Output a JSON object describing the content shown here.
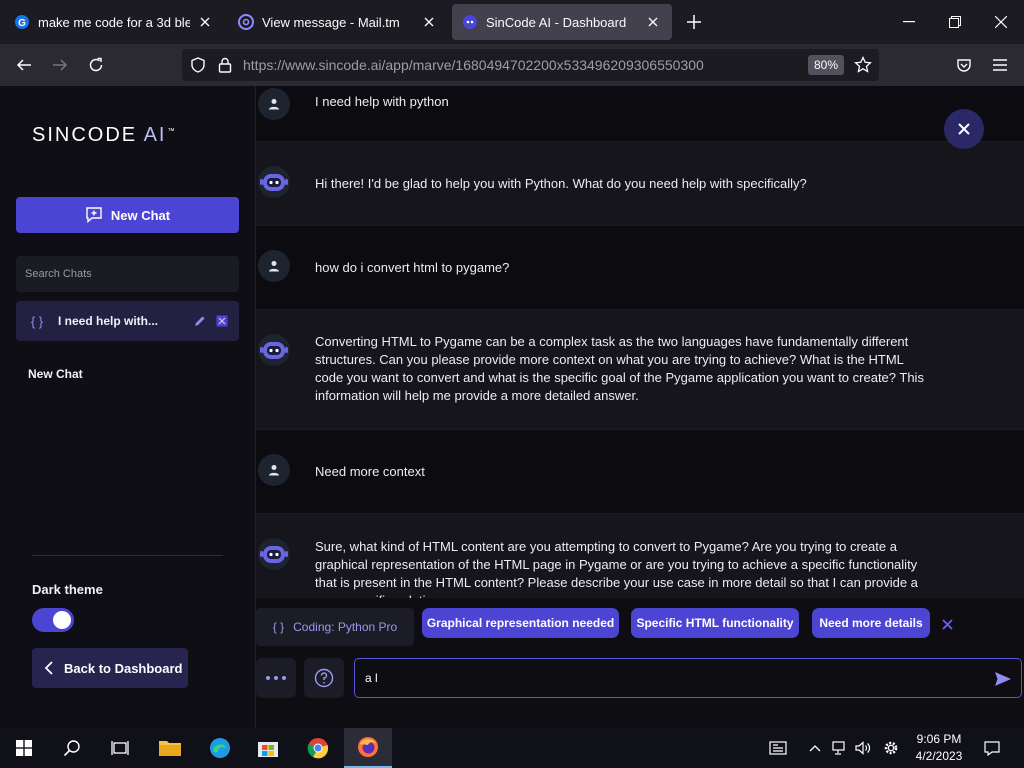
{
  "browser": {
    "tabs": [
      {
        "title": "make me code for a 3d blender",
        "active": false
      },
      {
        "title": "View message - Mail.tm",
        "active": false
      },
      {
        "title": "SinCode AI - Dashboard",
        "active": true
      }
    ],
    "url": "https://www.sincode.ai/app/marve/1680494702200x533496209306550300",
    "zoom": "80%"
  },
  "sidebar": {
    "logo_main": "SINCODE ",
    "logo_ai": "AI",
    "logo_tm": "™",
    "new_chat_label": "New Chat",
    "search_placeholder": "Search Chats",
    "chat_items": [
      {
        "braces": "{ }",
        "label": "I need help with..."
      }
    ],
    "plain_chat": "New Chat",
    "theme_label": "Dark theme",
    "dark_theme_on": true,
    "back_label": "Back to Dashboard"
  },
  "chat": {
    "messages": [
      {
        "role": "user",
        "text": "I need help with python"
      },
      {
        "role": "bot",
        "text": "Hi there! I'd be glad to help you with Python. What do you need help with specifically?"
      },
      {
        "role": "user",
        "text": "how do i convert html to pygame?"
      },
      {
        "role": "bot",
        "text": "Converting HTML to Pygame can be a complex task as the two languages have fundamentally different structures. Can you please provide more context on what you are trying to achieve? What is the HTML code you want to convert and what is the specific goal of the Pygame application you want to create? This information will help me provide a more detailed answer."
      },
      {
        "role": "user",
        "text": "Need more context"
      },
      {
        "role": "bot",
        "text": "Sure, what kind of HTML content are you attempting to convert to Pygame? Are you trying to create a graphical representation of the HTML page in Pygame or are you trying to achieve a specific functionality that is present in the HTML content? Please describe your use case in more detail so that I can provide a more specific solution."
      }
    ]
  },
  "suggestions": {
    "mode_braces": "{ }",
    "mode_label": "Coding: Python Pro",
    "pills": [
      "Graphical representation needed",
      "Specific HTML functionality",
      "Need more details"
    ]
  },
  "composer": {
    "value": "a l"
  },
  "taskbar": {
    "time": "9:06 PM",
    "date": "4/2/2023"
  },
  "colors": {
    "accent": "#4c45d3",
    "sidebar_active": "#232142",
    "bot_row": "#15151b"
  }
}
